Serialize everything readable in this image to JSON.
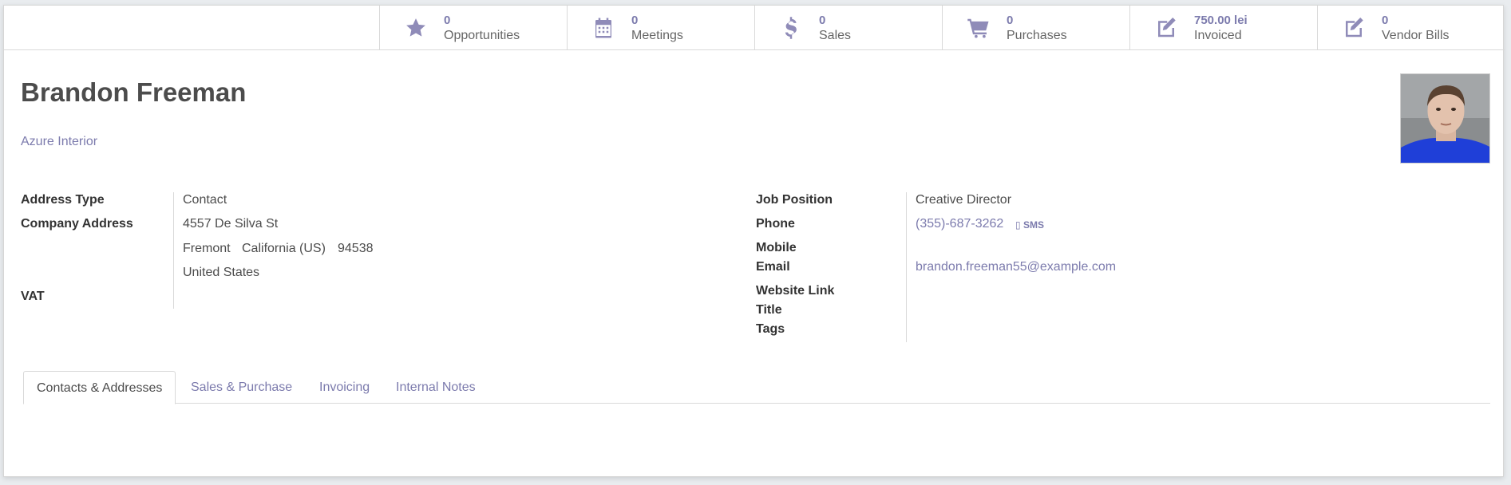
{
  "stat_buttons": [
    {
      "value": "0",
      "label": "Opportunities",
      "icon": "star-icon"
    },
    {
      "value": "0",
      "label": "Meetings",
      "icon": "calendar-icon"
    },
    {
      "value": "0",
      "label": "Sales",
      "icon": "dollar-icon"
    },
    {
      "value": "0",
      "label": "Purchases",
      "icon": "cart-icon"
    },
    {
      "value": "750.00 lei",
      "label": "Invoiced",
      "icon": "edit-icon"
    },
    {
      "value": "0",
      "label": "Vendor Bills",
      "icon": "edit-icon"
    }
  ],
  "partner": {
    "name": "Brandon Freeman",
    "company": "Azure Interior",
    "avatar_icon": "person-photo"
  },
  "left_fields": {
    "address_type_label": "Address Type",
    "address_type_value": "Contact",
    "company_address_label": "Company Address",
    "street": "4557 De Silva St",
    "city": "Fremont",
    "state": "California (US)",
    "zip": "94538",
    "country": "United States",
    "vat_label": "VAT"
  },
  "right_fields": {
    "job_position_label": "Job Position",
    "job_position_value": "Creative Director",
    "phone_label": "Phone",
    "phone_value": "(355)-687-3262",
    "sms_label": "SMS",
    "mobile_label": "Mobile",
    "email_label": "Email",
    "email_value": "brandon.freeman55@example.com",
    "website_label": "Website Link",
    "title_label": "Title",
    "tags_label": "Tags"
  },
  "tabs": [
    {
      "label": "Contacts & Addresses",
      "active": true
    },
    {
      "label": "Sales & Purchase",
      "active": false
    },
    {
      "label": "Invoicing",
      "active": false
    },
    {
      "label": "Internal Notes",
      "active": false
    }
  ],
  "colors": {
    "accent": "#7c7bad",
    "icon": "#8f8bb8",
    "border": "#d9d9d9"
  }
}
